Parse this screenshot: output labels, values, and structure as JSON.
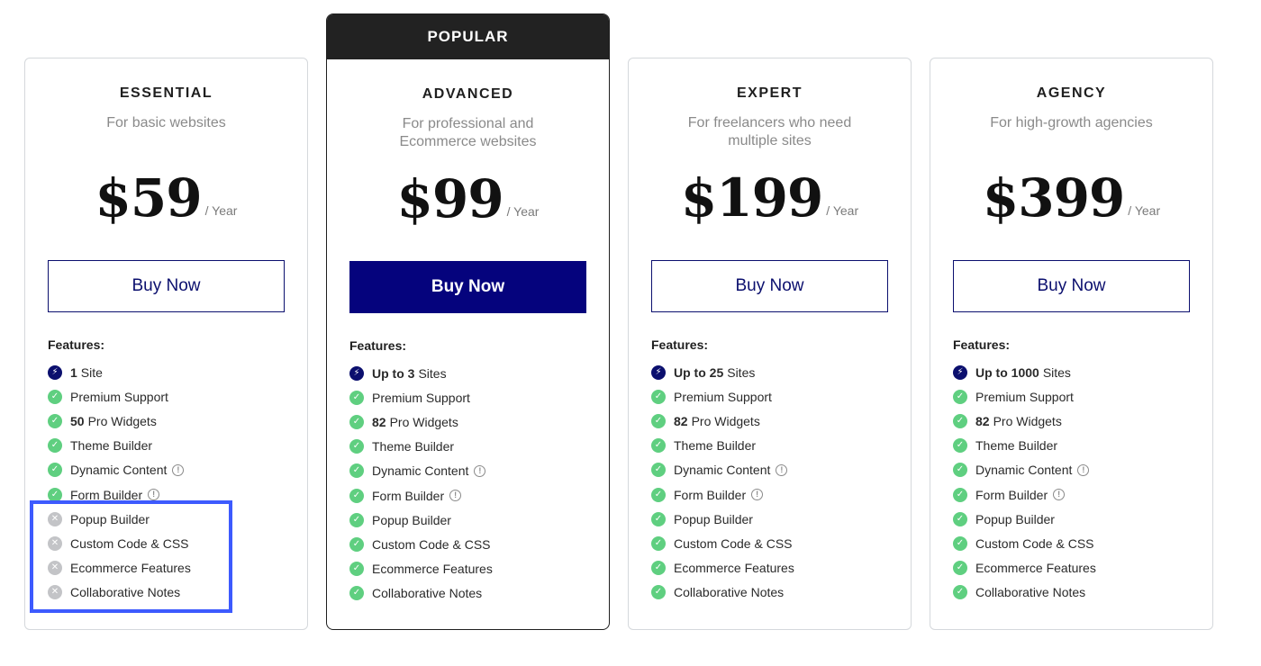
{
  "popular_label": "POPULAR",
  "period": "/ Year",
  "features_title": "Features:",
  "buy_label": "Buy Now",
  "colors": {
    "accent": "#05037d",
    "check": "#5fcf80",
    "disabled": "#c3c4c7",
    "highlight": "#3d5afe"
  },
  "plans": [
    {
      "name": "ESSENTIAL",
      "desc": "For basic websites",
      "price": "$59",
      "sites_bold": "1",
      "sites_text": "Site",
      "widgets_bold": "50",
      "widgets_text": "Pro Widgets"
    },
    {
      "name": "ADVANCED",
      "desc": "For professional and Ecommerce websites",
      "price": "$99",
      "sites_bold": "Up to 3",
      "sites_text": "Sites",
      "widgets_bold": "82",
      "widgets_text": "Pro Widgets"
    },
    {
      "name": "EXPERT",
      "desc": "For freelancers who need multiple sites",
      "price": "$199",
      "sites_bold": "Up to 25",
      "sites_text": "Sites",
      "widgets_bold": "82",
      "widgets_text": "Pro Widgets"
    },
    {
      "name": "AGENCY",
      "desc": "For high-growth agencies",
      "price": "$399",
      "sites_bold": "Up to 1000",
      "sites_text": "Sites",
      "widgets_bold": "82",
      "widgets_text": "Pro Widgets"
    }
  ],
  "features": {
    "premium_support": "Premium Support",
    "theme_builder": "Theme Builder",
    "dynamic_content": "Dynamic Content",
    "form_builder": "Form Builder",
    "popup_builder": "Popup Builder",
    "custom_code": "Custom Code & CSS",
    "ecommerce": "Ecommerce Features",
    "collab_notes": "Collaborative Notes"
  },
  "info_glyph": "!"
}
